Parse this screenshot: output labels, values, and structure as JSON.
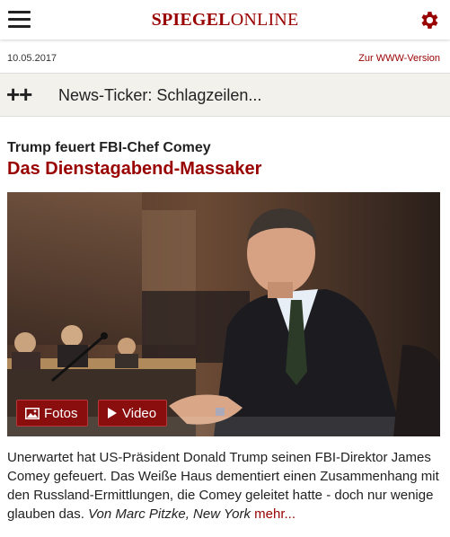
{
  "header": {
    "logo_bold": "SPIEGEL",
    "logo_thin": "ONLINE",
    "brand_color": "#990000"
  },
  "meta": {
    "date": "10.05.2017",
    "www_link": "Zur WWW-Version"
  },
  "ticker": {
    "icon": "plus-plus-icon",
    "label": "News-Ticker: Schlagzeilen..."
  },
  "article": {
    "kicker": "Trump feuert FBI-Chef Comey",
    "headline": "Das Dienstagabend-Massaker",
    "buttons": {
      "photos_label": "Fotos",
      "video_label": "Video"
    },
    "teaser": "Unerwartet hat US-Präsident Donald Trump seinen FBI-Direktor James Comey gefeuert. Das Weiße Haus dementiert einen Zusammenhang mit den Russland-Ermittlungen, die Comey geleitet hatte - doch nur wenige glauben das.",
    "author": "Von Marc Pitzke, New York",
    "more_label": "mehr..."
  }
}
